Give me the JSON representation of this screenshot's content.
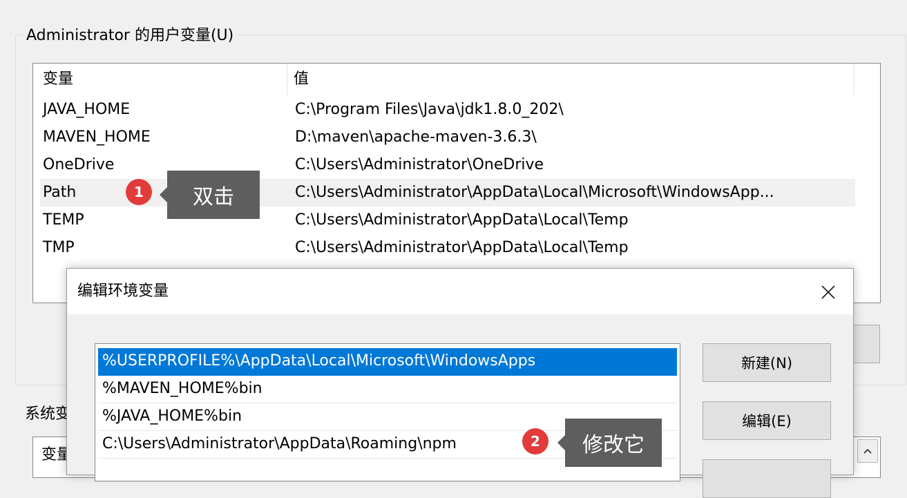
{
  "user_vars": {
    "group_title": "Administrator 的用户变量(U)",
    "columns": {
      "name": "变量",
      "value": "值"
    },
    "rows": [
      {
        "name": "JAVA_HOME",
        "value": "C:\\Program Files\\Java\\jdk1.8.0_202\\"
      },
      {
        "name": "MAVEN_HOME",
        "value": "D:\\maven\\apache-maven-3.6.3\\"
      },
      {
        "name": "OneDrive",
        "value": "C:\\Users\\Administrator\\OneDrive"
      },
      {
        "name": "Path",
        "value": "C:\\Users\\Administrator\\AppData\\Local\\Microsoft\\WindowsApp..."
      },
      {
        "name": "TEMP",
        "value": "C:\\Users\\Administrator\\AppData\\Local\\Temp"
      },
      {
        "name": "TMP",
        "value": "C:\\Users\\Administrator\\AppData\\Local\\Temp"
      }
    ]
  },
  "system_vars": {
    "group_title": "系统变",
    "column_name": "变量"
  },
  "annotations": {
    "step1": {
      "badge": "1",
      "text": "双击"
    },
    "step2": {
      "badge": "2",
      "text": "修改它"
    }
  },
  "edit_dialog": {
    "title": "编辑环境变量",
    "entries": [
      "%USERPROFILE%\\AppData\\Local\\Microsoft\\WindowsApps",
      "%MAVEN_HOME%bin",
      "%JAVA_HOME%bin",
      "C:\\Users\\Administrator\\AppData\\Roaming\\npm"
    ],
    "buttons": {
      "new": "新建(N)",
      "edit": "编辑(E)"
    }
  },
  "colors": {
    "selection": "#0078d7",
    "badge": "#e23b3b",
    "callout": "#5e5e5e"
  },
  "icons": [
    "close-icon",
    "chevron-up-icon"
  ]
}
